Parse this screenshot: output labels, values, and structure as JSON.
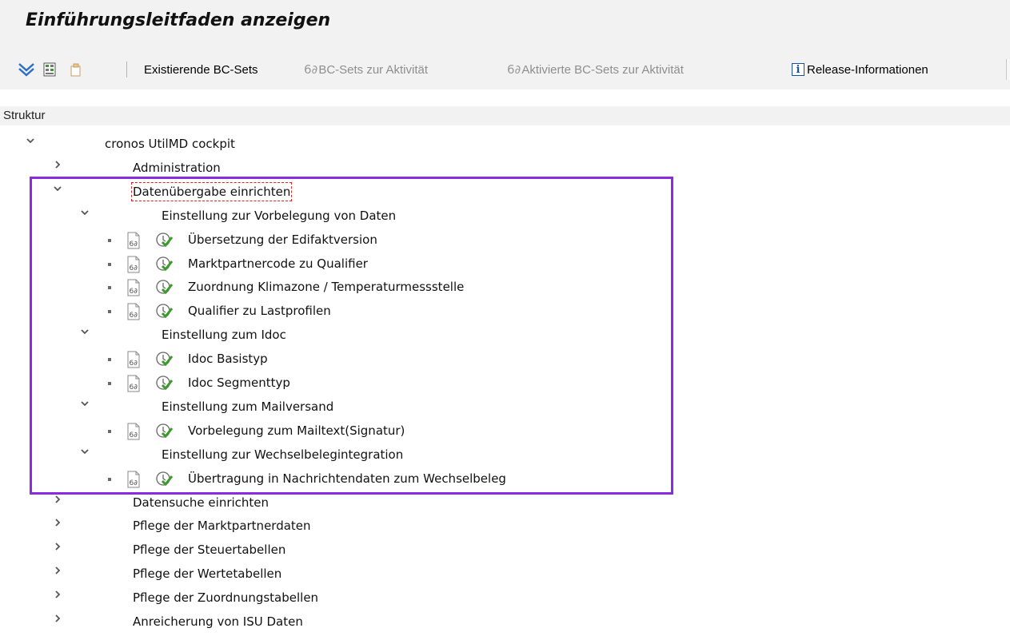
{
  "window": {
    "title": "Einführungsleitfaden anzeigen"
  },
  "toolbar": {
    "icons": [
      "expand-all-icon",
      "transport-icon",
      "copy-icon"
    ],
    "existing_bc_sets": "Existierende BC-Sets",
    "bc_sets_activity_glyph": "6∂",
    "bc_sets_activity": "BC-Sets zur Aktivität",
    "activated_bc_sets_glyph": "6∂",
    "activated_bc_sets": "Aktivierte BC-Sets zur Aktivität",
    "release_info_icon": "i",
    "release_info": "Release-Informationen"
  },
  "structure": {
    "header": "Struktur",
    "nodes": [
      {
        "label": "cronos UtilMD cockpit",
        "state": "expanded",
        "level": 0
      },
      {
        "label": "Administration",
        "state": "collapsed",
        "level": 1
      },
      {
        "label": "Datenübergabe einrichten",
        "state": "expanded",
        "level": 1,
        "focused": true
      },
      {
        "label": "Einstellung zur Vorbelegung von Daten",
        "state": "expanded",
        "level": 2
      },
      {
        "label": "Übersetzung der Edifaktversion",
        "state": "leaf",
        "level": 3
      },
      {
        "label": "Marktpartnercode zu Qualifier",
        "state": "leaf",
        "level": 3
      },
      {
        "label": "Zuordnung Klimazone / Temperaturmessstelle",
        "state": "leaf",
        "level": 3
      },
      {
        "label": "Qualifier zu Lastprofilen",
        "state": "leaf",
        "level": 3
      },
      {
        "label": "Einstellung zum Idoc",
        "state": "expanded",
        "level": 2
      },
      {
        "label": "Idoc Basistyp",
        "state": "leaf",
        "level": 3
      },
      {
        "label": "Idoc Segmenttyp",
        "state": "leaf",
        "level": 3
      },
      {
        "label": "Einstellung zum Mailversand",
        "state": "expanded",
        "level": 2
      },
      {
        "label": "Vorbelegung zum Mailtext(Signatur)",
        "state": "leaf",
        "level": 3
      },
      {
        "label": "Einstellung zur Wechselbelegintegration",
        "state": "expanded",
        "level": 2
      },
      {
        "label": "Übertragung in Nachrichtendaten zum Wechselbeleg",
        "state": "leaf",
        "level": 3
      },
      {
        "label": "Datensuche einrichten",
        "state": "collapsed",
        "level": 1
      },
      {
        "label": "Pflege der Marktpartnerdaten",
        "state": "collapsed",
        "level": 1
      },
      {
        "label": "Pflege der Steuertabellen",
        "state": "collapsed",
        "level": 1
      },
      {
        "label": "Pflege der Wertetabellen",
        "state": "collapsed",
        "level": 1
      },
      {
        "label": "Pflege der Zuordnungstabellen",
        "state": "collapsed",
        "level": 1
      },
      {
        "label": "Anreicherung von ISU Daten",
        "state": "collapsed",
        "level": 1
      }
    ]
  },
  "colors": {
    "highlight_frame": "#8a2be2",
    "focus_outline": "#dd2222",
    "exec_icon_check": "#3a9a2a"
  }
}
